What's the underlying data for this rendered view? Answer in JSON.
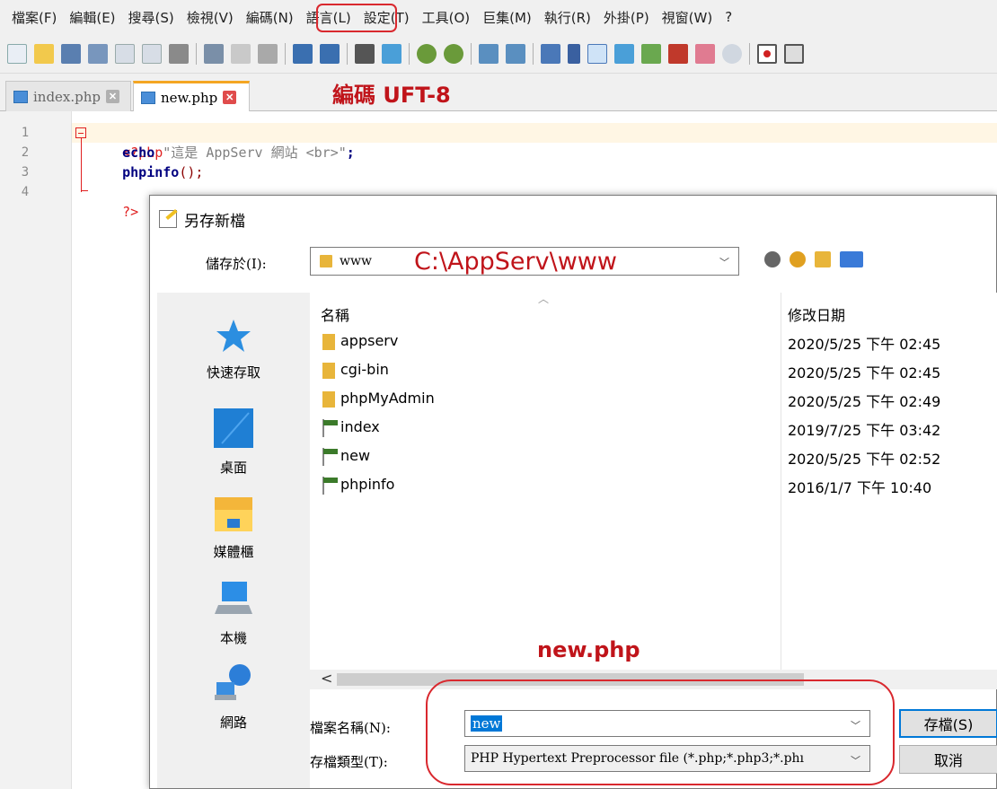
{
  "menu": {
    "items": [
      "檔案(F)",
      "編輯(E)",
      "搜尋(S)",
      "檢視(V)",
      "編碼(N)",
      "語言(L)",
      "設定(T)",
      "工具(O)",
      "巨集(M)",
      "執行(R)",
      "外掛(P)",
      "視窗(W)",
      "?"
    ]
  },
  "tabs": [
    {
      "label": "index.php"
    },
    {
      "label": "new.php"
    }
  ],
  "annotations": {
    "encoding": "編碼 UFT-8",
    "path": "C:\\AppServ\\www",
    "filename": "new.php"
  },
  "editor": {
    "line_numbers": [
      "1",
      "2",
      "3",
      "4"
    ],
    "lines": {
      "l1_open": "<?php",
      "l2_kw": "echo",
      "l2_str": "\"這是 AppServ 網站 <br>\"",
      "l2_end": ";",
      "l3_fn": "phpinfo",
      "l3_end": "();",
      "l4_close": "?>"
    }
  },
  "dialog": {
    "title": "另存新檔",
    "save_in_label": "儲存於(I):",
    "save_in_value": "www",
    "places": [
      "快速存取",
      "桌面",
      "媒體櫃",
      "本機",
      "網路"
    ],
    "columns": {
      "name": "名稱",
      "date": "修改日期"
    },
    "files": [
      {
        "name": "appserv",
        "date": "2020/5/25 下午 02:45",
        "type": "folder"
      },
      {
        "name": "cgi-bin",
        "date": "2020/5/25 下午 02:45",
        "type": "folder"
      },
      {
        "name": "phpMyAdmin",
        "date": "2020/5/25 下午 02:49",
        "type": "folder"
      },
      {
        "name": "index",
        "date": "2019/7/25 下午 03:42",
        "type": "php"
      },
      {
        "name": "new",
        "date": "2020/5/25 下午 02:52",
        "type": "php"
      },
      {
        "name": "phpinfo",
        "date": "2016/1/7 下午 10:40",
        "type": "php"
      }
    ],
    "filename_label": "檔案名稱(N):",
    "filename_value": "new",
    "filetype_label": "存檔類型(T):",
    "filetype_value": "PHP Hypertext Preprocessor file (*.php;*.php3;*.phı",
    "save_button": "存檔(S)",
    "cancel_button": "取消"
  },
  "colors": {
    "annotation_red": "#c0141a",
    "selection_blue": "#0078d7",
    "active_tab_accent": "#f4a623",
    "folder_yellow": "#e8b53a"
  }
}
